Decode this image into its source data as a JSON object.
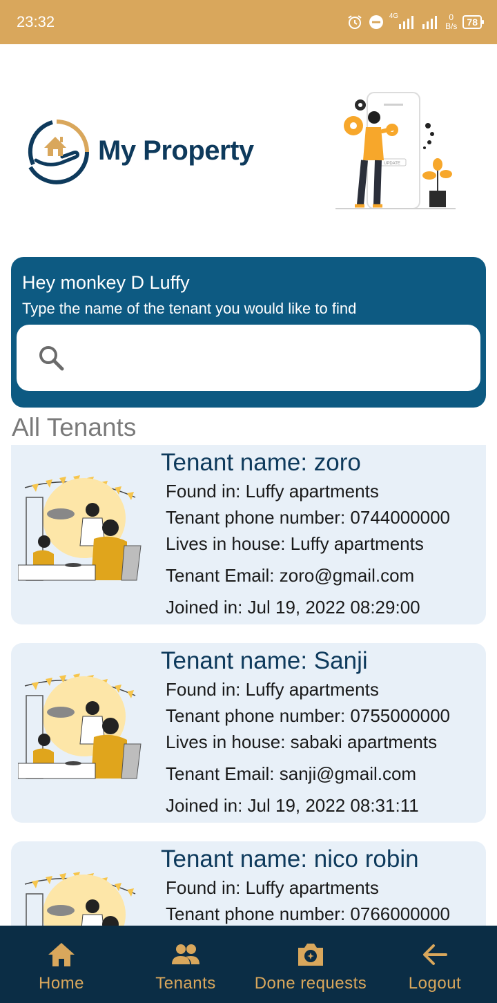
{
  "status_bar": {
    "time": "23:32",
    "network_type": "4G",
    "net_speed_value": "0",
    "net_speed_unit": "B/s",
    "battery": "78"
  },
  "header": {
    "app_title": "My Property",
    "logo_icon": "house-in-hand-icon",
    "hero_illustration": "person-update-phone-illustration"
  },
  "search": {
    "greeting": "Hey monkey D Luffy",
    "hint": "Type the name of the tenant you would like to find",
    "placeholder": "",
    "value": ""
  },
  "section_title": "All Tenants",
  "tenants": [
    {
      "name": "Tenant name: zoro",
      "found_in": "Found in: Luffy apartments",
      "phone": "Tenant phone number: 0744000000",
      "house": "Lives in house: Luffy apartments",
      "email": "Tenant Email: zoro@gmail.com",
      "joined": "Joined in: Jul 19, 2022 08:29:00"
    },
    {
      "name": "Tenant name: Sanji",
      "found_in": "Found in: Luffy apartments",
      "phone": "Tenant phone number: 0755000000",
      "house": "Lives in house: sabaki apartments",
      "email": "Tenant Email: sanji@gmail.com",
      "joined": "Joined in: Jul 19, 2022 08:31:11"
    },
    {
      "name": "Tenant name: nico robin",
      "found_in": "Found in: Luffy apartments",
      "phone": "Tenant phone number: 0766000000",
      "house": "",
      "email": "",
      "joined": ""
    }
  ],
  "bottom_nav": [
    {
      "label": "Home",
      "icon": "home-icon"
    },
    {
      "label": "Tenants",
      "icon": "people-icon"
    },
    {
      "label": "Done requests",
      "icon": "camera-icon"
    },
    {
      "label": "Logout",
      "icon": "arrow-left-icon"
    }
  ],
  "colors": {
    "status_bar": "#d9a75c",
    "brand_dark": "#0e3a5c",
    "search_card": "#0d5a82",
    "card_bg": "#e8f0f8",
    "nav_bg": "#0b2d45",
    "nav_accent": "#d9a75c"
  }
}
